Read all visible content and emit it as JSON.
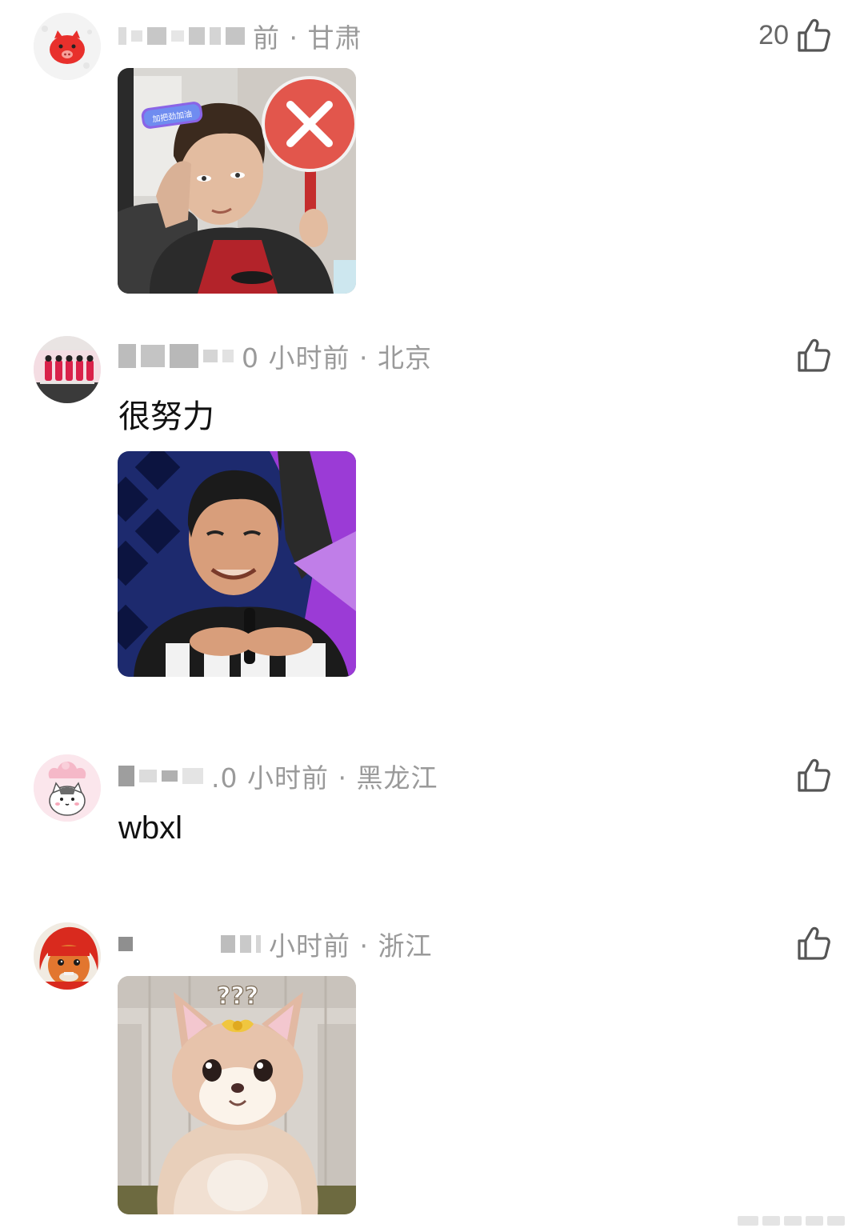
{
  "comments": [
    {
      "meta": "前 · 甘肃",
      "like_count": "20",
      "text": "",
      "sticker_badge": "加把劲加油",
      "avatar_icon": "red-pig-avatar-icon",
      "sticker_icon": "man-holding-red-x-sign"
    },
    {
      "meta": "0 小时前 · 北京",
      "like_count": "",
      "text": "很努力",
      "avatar_icon": "red-uniform-guards-avatar-icon",
      "sticker_icon": "man-smiling-with-microphone"
    },
    {
      "meta": ".0 小时前 · 黑龙江",
      "like_count": "",
      "text": "wbxl",
      "avatar_icon": "pink-cat-avatar-icon",
      "sticker_icon": ""
    },
    {
      "meta": "小时前 · 浙江",
      "like_count": "",
      "text": "",
      "sticker_badge": "???",
      "avatar_icon": "red-hair-cartoon-avatar-icon",
      "sticker_icon": "pink-fox-mascot-confused"
    }
  ],
  "colors": {
    "meta_text": "#9a9a9a",
    "comment_text": "#111111",
    "like_icon": "#555555",
    "redaction": "#cfcfcf"
  }
}
